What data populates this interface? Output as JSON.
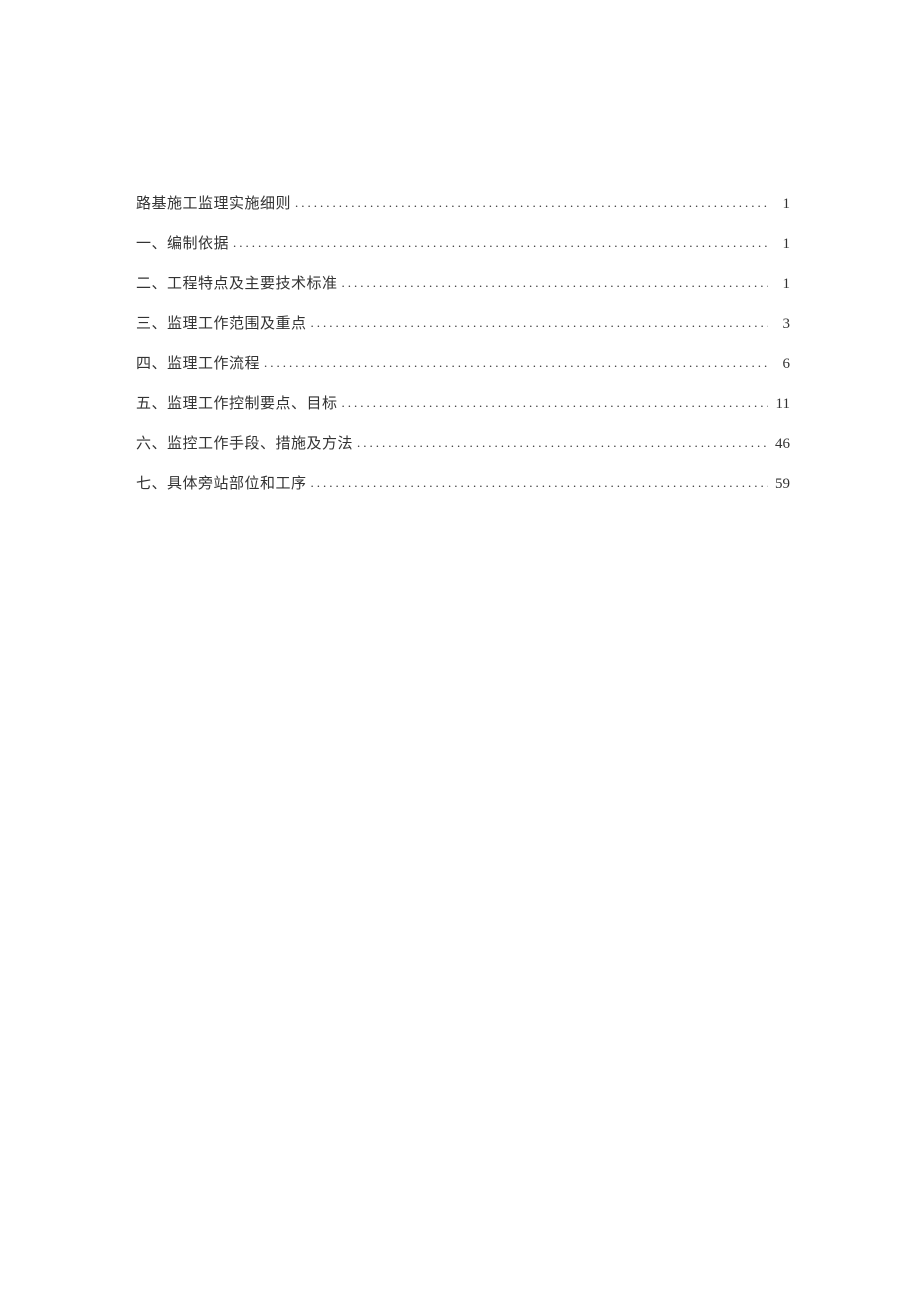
{
  "toc": {
    "entries": [
      {
        "title": "路基施工监理实施细则",
        "page": "1"
      },
      {
        "title": "一、编制依据",
        "page": "1"
      },
      {
        "title": "二、工程特点及主要技术标准",
        "page": "1"
      },
      {
        "title": "三、监理工作范围及重点",
        "page": "3"
      },
      {
        "title": "四、监理工作流程",
        "page": "6"
      },
      {
        "title": "五、监理工作控制要点、目标",
        "page": "11"
      },
      {
        "title": "六、监控工作手段、措施及方法",
        "page": "46"
      },
      {
        "title": "七、具体旁站部位和工序",
        "page": "59"
      }
    ],
    "dot_leader": "...................................................................................................................."
  }
}
